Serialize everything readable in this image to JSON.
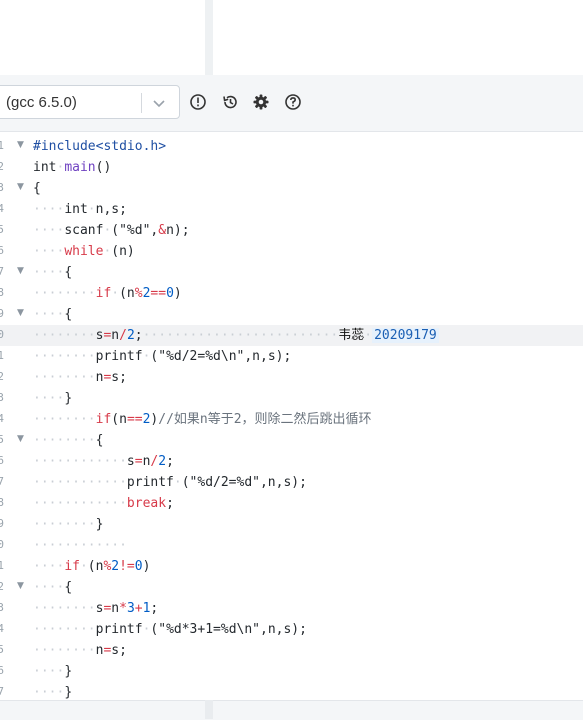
{
  "toolbar": {
    "compiler_value": "(gcc 6.5.0)"
  },
  "icons": {
    "info": "exclamation-circle-icon",
    "history": "history-icon",
    "settings": "gear-icon",
    "help": "question-circle-icon"
  },
  "editor": {
    "line_numbers": [
      "1",
      "2",
      "3",
      "4",
      "5",
      "6",
      "7",
      "8",
      "9",
      "0",
      "1",
      "2",
      "3",
      "4",
      "5",
      "6",
      "7",
      "8",
      "9",
      "0",
      "1",
      "2",
      "3",
      "4",
      "5",
      "6",
      "7"
    ],
    "note": {
      "name": "韦蕊",
      "id": "20209179"
    },
    "comment": "//如果n等于2，则除二然后跳出循环"
  }
}
